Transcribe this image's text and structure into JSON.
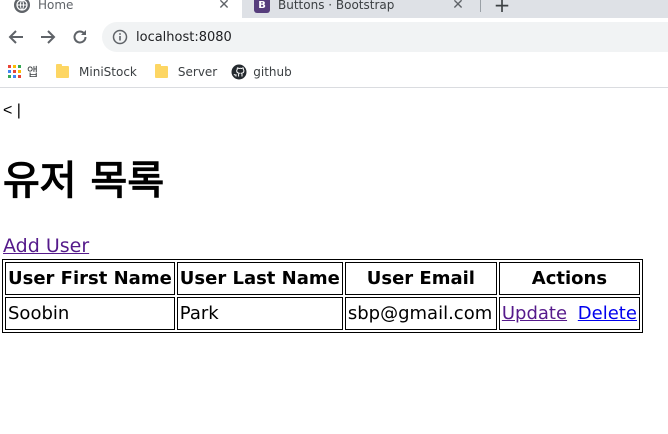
{
  "browser": {
    "tabs": [
      {
        "title": "Home",
        "active": true,
        "favicon": "globe-icon"
      },
      {
        "title": "Buttons · Bootstrap",
        "active": false,
        "favicon": "bootstrap-icon",
        "favicon_letter": "B"
      }
    ],
    "address": "localhost:8080",
    "bookmarks": [
      {
        "label": "앱",
        "icon": "apps-grid-icon"
      },
      {
        "label": "MiniStock",
        "icon": "folder-icon"
      },
      {
        "label": "Server",
        "icon": "folder-icon"
      },
      {
        "label": "github",
        "icon": "github-icon"
      }
    ]
  },
  "page": {
    "back_link": "< |",
    "title": "유저 목록",
    "add_user_link": "Add User",
    "table": {
      "headers": [
        "User First Name",
        "User Last Name",
        "User Email",
        "Actions"
      ],
      "rows": [
        {
          "first_name": "Soobin",
          "last_name": "Park",
          "email": "sbp@gmail.com",
          "update_label": "Update",
          "delete_label": "Delete"
        }
      ]
    }
  },
  "colors": {
    "visited_link": "#551a8b",
    "link": "#0000ee",
    "tabstrip": "#dee1e6",
    "omnibox": "#f1f3f4"
  }
}
